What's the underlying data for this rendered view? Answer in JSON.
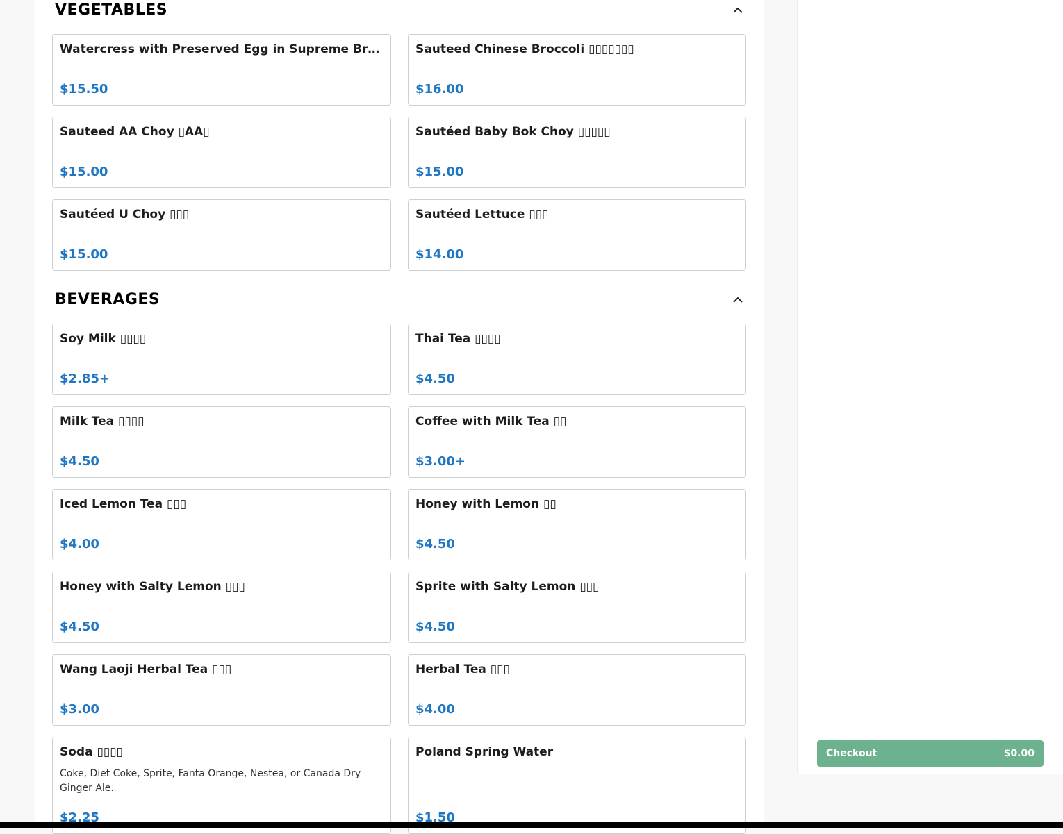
{
  "sections": [
    {
      "title": "VEGETABLES",
      "items": [
        {
          "name": "Watercress with Preserved Egg in Supreme Broth",
          "price": "$15.50"
        },
        {
          "name": "Sauteed Chinese Broccoli ▯▯▯▯▯▯▯",
          "price": "$16.00"
        },
        {
          "name": "Sauteed AA Choy ▯AA▯",
          "price": "$15.00"
        },
        {
          "name": "Sautéed Baby Bok Choy ▯▯▯▯▯",
          "price": "$15.00"
        },
        {
          "name": "Sautéed U Choy ▯▯▯",
          "price": "$15.00"
        },
        {
          "name": "Sautéed Lettuce ▯▯▯",
          "price": "$14.00"
        }
      ]
    },
    {
      "title": "BEVERAGES",
      "items": [
        {
          "name": "Soy Milk ▯▯▯▯",
          "price": "$2.85+"
        },
        {
          "name": "Thai Tea ▯▯▯▯",
          "price": "$4.50"
        },
        {
          "name": "Milk Tea ▯▯▯▯",
          "price": "$4.50"
        },
        {
          "name": "Coffee with Milk Tea ▯▯",
          "price": "$3.00+"
        },
        {
          "name": "Iced Lemon Tea ▯▯▯",
          "price": "$4.00"
        },
        {
          "name": "Honey with Lemon ▯▯",
          "price": "$4.50"
        },
        {
          "name": "Honey with Salty Lemon ▯▯▯",
          "price": "$4.50"
        },
        {
          "name": "Sprite with Salty Lemon ▯▯▯",
          "price": "$4.50"
        },
        {
          "name": "Wang Laoji Herbal Tea ▯▯▯",
          "price": "$3.00"
        },
        {
          "name": "Herbal Tea ▯▯▯",
          "price": "$4.00"
        },
        {
          "name": "Soda ▯▯▯▯",
          "description": "Coke, Diet Coke, Sprite, Fanta Orange, Nestea, or Canada Dry Ginger Ale.",
          "price": "$2.25"
        },
        {
          "name": "Poland Spring Water",
          "price": "$1.50"
        }
      ]
    }
  ],
  "cart": {
    "checkout_label": "Checkout",
    "total": "$0.00"
  },
  "icons": {
    "collapse": "chevron-up-icon"
  },
  "colors": {
    "price": "#1f76c2",
    "checkout": "#6cb28e"
  }
}
